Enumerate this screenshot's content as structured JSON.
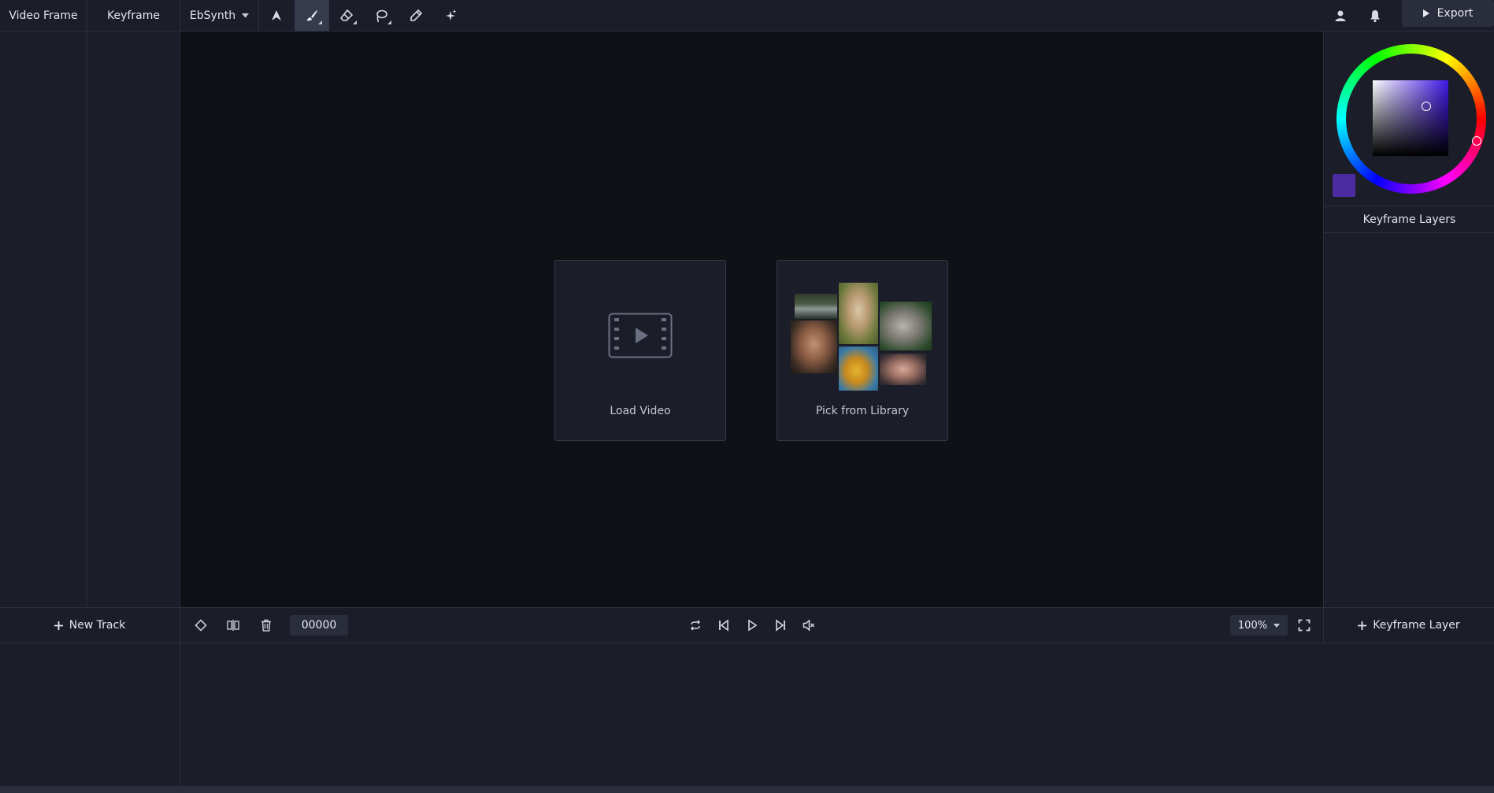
{
  "topbar": {
    "tabs": [
      {
        "label": "Video Frame"
      },
      {
        "label": "Keyframe"
      },
      {
        "label": "EbSynth"
      }
    ],
    "tools": [
      "select-arrow-icon",
      "brush-icon",
      "eraser-icon",
      "lasso-icon",
      "eyedropper-icon",
      "sparkle-icon"
    ],
    "active_tool": "brush-icon",
    "export_label": "Export"
  },
  "canvas": {
    "load_video_label": "Load Video",
    "pick_library_label": "Pick from Library"
  },
  "right_panel": {
    "swatch_color": "#4b2ca0",
    "hue_color": "#3f17e6",
    "layers_title": "Keyframe Layers"
  },
  "bottombar": {
    "new_track_label": "New Track",
    "frame_number": "00000",
    "zoom": "100%",
    "add_keyframe_layer_label": "Keyframe Layer"
  },
  "colors": {
    "background": "#0f1117",
    "panel": "#1b1e29",
    "border": "#2b2f3c",
    "active_tool": "#353a4c"
  }
}
